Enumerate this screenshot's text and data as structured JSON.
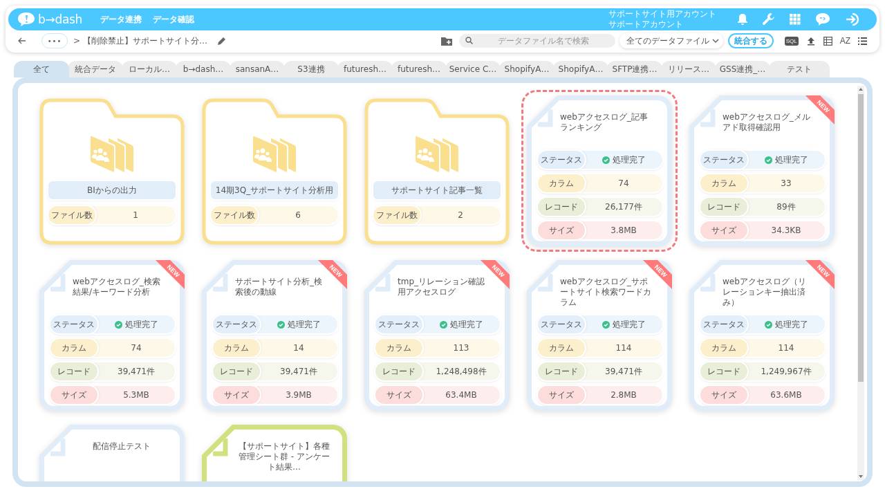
{
  "header": {
    "logo": "b→dash",
    "nav": [
      "データ連携",
      "データ確認"
    ],
    "account": [
      "サポートサイト用アカウント",
      "サポートアカウント"
    ]
  },
  "toolbar": {
    "more_button": "•••",
    "separator": ">",
    "breadcrumb": "【削除禁止】サポートサイト分…",
    "search": {
      "placeholder": "データファイル名で検索"
    },
    "filter": {
      "value": "全てのデータファイル"
    },
    "merge_button": "統合する",
    "sql_label": "SQL",
    "sort_label": "AZ"
  },
  "tabs": [
    {
      "label": "全て",
      "selected": true
    },
    {
      "label": "統合データ",
      "selected": false
    },
    {
      "label": "ローカル…",
      "selected": false
    },
    {
      "label": "b→dash…",
      "selected": false
    },
    {
      "label": "sansanA…",
      "selected": false
    },
    {
      "label": "S3連携",
      "selected": false
    },
    {
      "label": "futuresh…",
      "selected": false
    },
    {
      "label": "futuresh…",
      "selected": false
    },
    {
      "label": "Service C…",
      "selected": false
    },
    {
      "label": "ShopifyA…",
      "selected": false
    },
    {
      "label": "ShopifyA…",
      "selected": false
    },
    {
      "label": "SFTP連携…",
      "selected": false
    },
    {
      "label": "リリース…",
      "selected": false
    },
    {
      "label": "GSS連携_…",
      "selected": false
    },
    {
      "label": "テスト",
      "selected": false
    }
  ],
  "items": [
    {
      "kind": "folder",
      "name": "BIからの出力",
      "count_label": "ファイル数",
      "count": "1",
      "selected": false
    },
    {
      "kind": "folder",
      "name": "14期3Q_サポートサイト分析用",
      "count_label": "ファイル数",
      "count": "6",
      "selected": false
    },
    {
      "kind": "folder",
      "name": "サポートサイト記事一覧",
      "count_label": "ファイル数",
      "count": "2",
      "selected": false
    },
    {
      "kind": "file",
      "title": "webアクセスログ_記事ランキング",
      "selected": true,
      "color": "#e0edf8",
      "rows": [
        {
          "kind": "status",
          "label": "ステータス",
          "value": "処理完了"
        },
        {
          "kind": "columns",
          "label": "カラム",
          "value": "74"
        },
        {
          "kind": "records",
          "label": "レコード",
          "value": "26,177件"
        },
        {
          "kind": "size",
          "label": "サイズ",
          "value": "3.8MB"
        }
      ]
    },
    {
      "kind": "file",
      "title": "webアクセスログ_メルアド取得確認用",
      "badge": "NEW",
      "selected": false,
      "color": "#e0edf8",
      "rows": [
        {
          "kind": "status",
          "label": "ステータス",
          "value": "処理完了"
        },
        {
          "kind": "columns",
          "label": "カラム",
          "value": "33"
        },
        {
          "kind": "records",
          "label": "レコード",
          "value": "89件"
        },
        {
          "kind": "size",
          "label": "サイズ",
          "value": "34.3KB"
        }
      ]
    },
    {
      "kind": "file",
      "title": "webアクセスログ_検索結果/キーワード分析",
      "badge": "NEW",
      "selected": false,
      "color": "#e0edf8",
      "rows": [
        {
          "kind": "status",
          "label": "ステータス",
          "value": "処理完了"
        },
        {
          "kind": "columns",
          "label": "カラム",
          "value": "74"
        },
        {
          "kind": "records",
          "label": "レコード",
          "value": "39,471件"
        },
        {
          "kind": "size",
          "label": "サイズ",
          "value": "5.3MB"
        }
      ]
    },
    {
      "kind": "file",
      "title": "サポートサイト分析_検索後の動線",
      "badge": "NEW",
      "selected": false,
      "color": "#e0edf8",
      "rows": [
        {
          "kind": "status",
          "label": "ステータス",
          "value": "処理完了"
        },
        {
          "kind": "columns",
          "label": "カラム",
          "value": "14"
        },
        {
          "kind": "records",
          "label": "レコード",
          "value": "39,471件"
        },
        {
          "kind": "size",
          "label": "サイズ",
          "value": "3.9MB"
        }
      ]
    },
    {
      "kind": "file",
      "title": "tmp_リレーション確認用アクセスログ",
      "badge": "NEW",
      "selected": false,
      "color": "#e0edf8",
      "rows": [
        {
          "kind": "status",
          "label": "ステータス",
          "value": "処理完了"
        },
        {
          "kind": "columns",
          "label": "カラム",
          "value": "113"
        },
        {
          "kind": "records",
          "label": "レコード",
          "value": "1,248,498件"
        },
        {
          "kind": "size",
          "label": "サイズ",
          "value": "63.4MB"
        }
      ]
    },
    {
      "kind": "file",
      "title": "webアクセスログ_サポートサイト検索ワードカラム",
      "badge": "NEW",
      "selected": false,
      "color": "#e0edf8",
      "rows": [
        {
          "kind": "status",
          "label": "ステータス",
          "value": "処理完了"
        },
        {
          "kind": "columns",
          "label": "カラム",
          "value": "114"
        },
        {
          "kind": "records",
          "label": "レコード",
          "value": "39,471件"
        },
        {
          "kind": "size",
          "label": "サイズ",
          "value": "2.8MB"
        }
      ]
    },
    {
      "kind": "file",
      "title": "webアクセスログ（リレーションキー抽出済み）",
      "badge": "NEW",
      "selected": false,
      "color": "#e0edf8",
      "rows": [
        {
          "kind": "status",
          "label": "ステータス",
          "value": "処理完了"
        },
        {
          "kind": "columns",
          "label": "カラム",
          "value": "114"
        },
        {
          "kind": "records",
          "label": "レコード",
          "value": "1,249,967件"
        },
        {
          "kind": "size",
          "label": "サイズ",
          "value": "63.6MB"
        }
      ]
    },
    {
      "kind": "file",
      "title": "配信停止テスト",
      "selected": false,
      "color": "#e0edf8"
    },
    {
      "kind": "file",
      "title": "【サポートサイト】各種管理シート群 - アンケート結果…",
      "selected": false,
      "color": "#d3e07f"
    }
  ]
}
